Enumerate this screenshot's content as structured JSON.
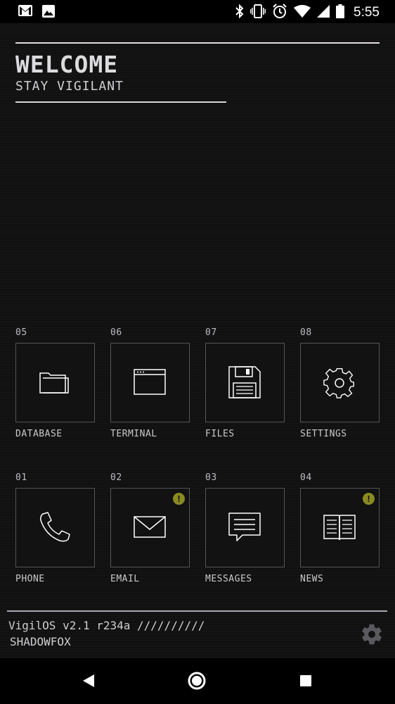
{
  "status_bar": {
    "time": "5:55",
    "left_icons": [
      "gmail-icon",
      "image-icon"
    ],
    "right_icons": [
      "bluetooth-icon",
      "vibrate-icon",
      "alarm-icon",
      "wifi-icon",
      "cell-signal-icon",
      "battery-icon"
    ]
  },
  "header": {
    "title": "WELCOME",
    "subtitle": "STAY VIGILANT"
  },
  "apps": [
    {
      "number": "05",
      "label": "DATABASE",
      "icon": "folder-icon",
      "alert": false
    },
    {
      "number": "06",
      "label": "TERMINAL",
      "icon": "window-icon",
      "alert": false
    },
    {
      "number": "07",
      "label": "FILES",
      "icon": "floppy-disk-icon",
      "alert": false
    },
    {
      "number": "08",
      "label": "SETTINGS",
      "icon": "gear-icon",
      "alert": false
    },
    {
      "number": "01",
      "label": "PHONE",
      "icon": "phone-icon",
      "alert": false
    },
    {
      "number": "02",
      "label": "EMAIL",
      "icon": "envelope-icon",
      "alert": true
    },
    {
      "number": "03",
      "label": "MESSAGES",
      "icon": "chat-bubble-icon",
      "alert": false
    },
    {
      "number": "04",
      "label": "NEWS",
      "icon": "book-icon",
      "alert": true
    }
  ],
  "alert_symbol": "!",
  "footer": {
    "version": "VigilOS v2.1 r234a //////////",
    "username": "SHADOWFOX"
  },
  "colors": {
    "background": "#111111",
    "text": "#d4d4d8",
    "tile_border": "#55555a",
    "alert": "#8a8a22"
  },
  "nav_bar": [
    "back-icon",
    "home-icon",
    "recents-icon"
  ]
}
